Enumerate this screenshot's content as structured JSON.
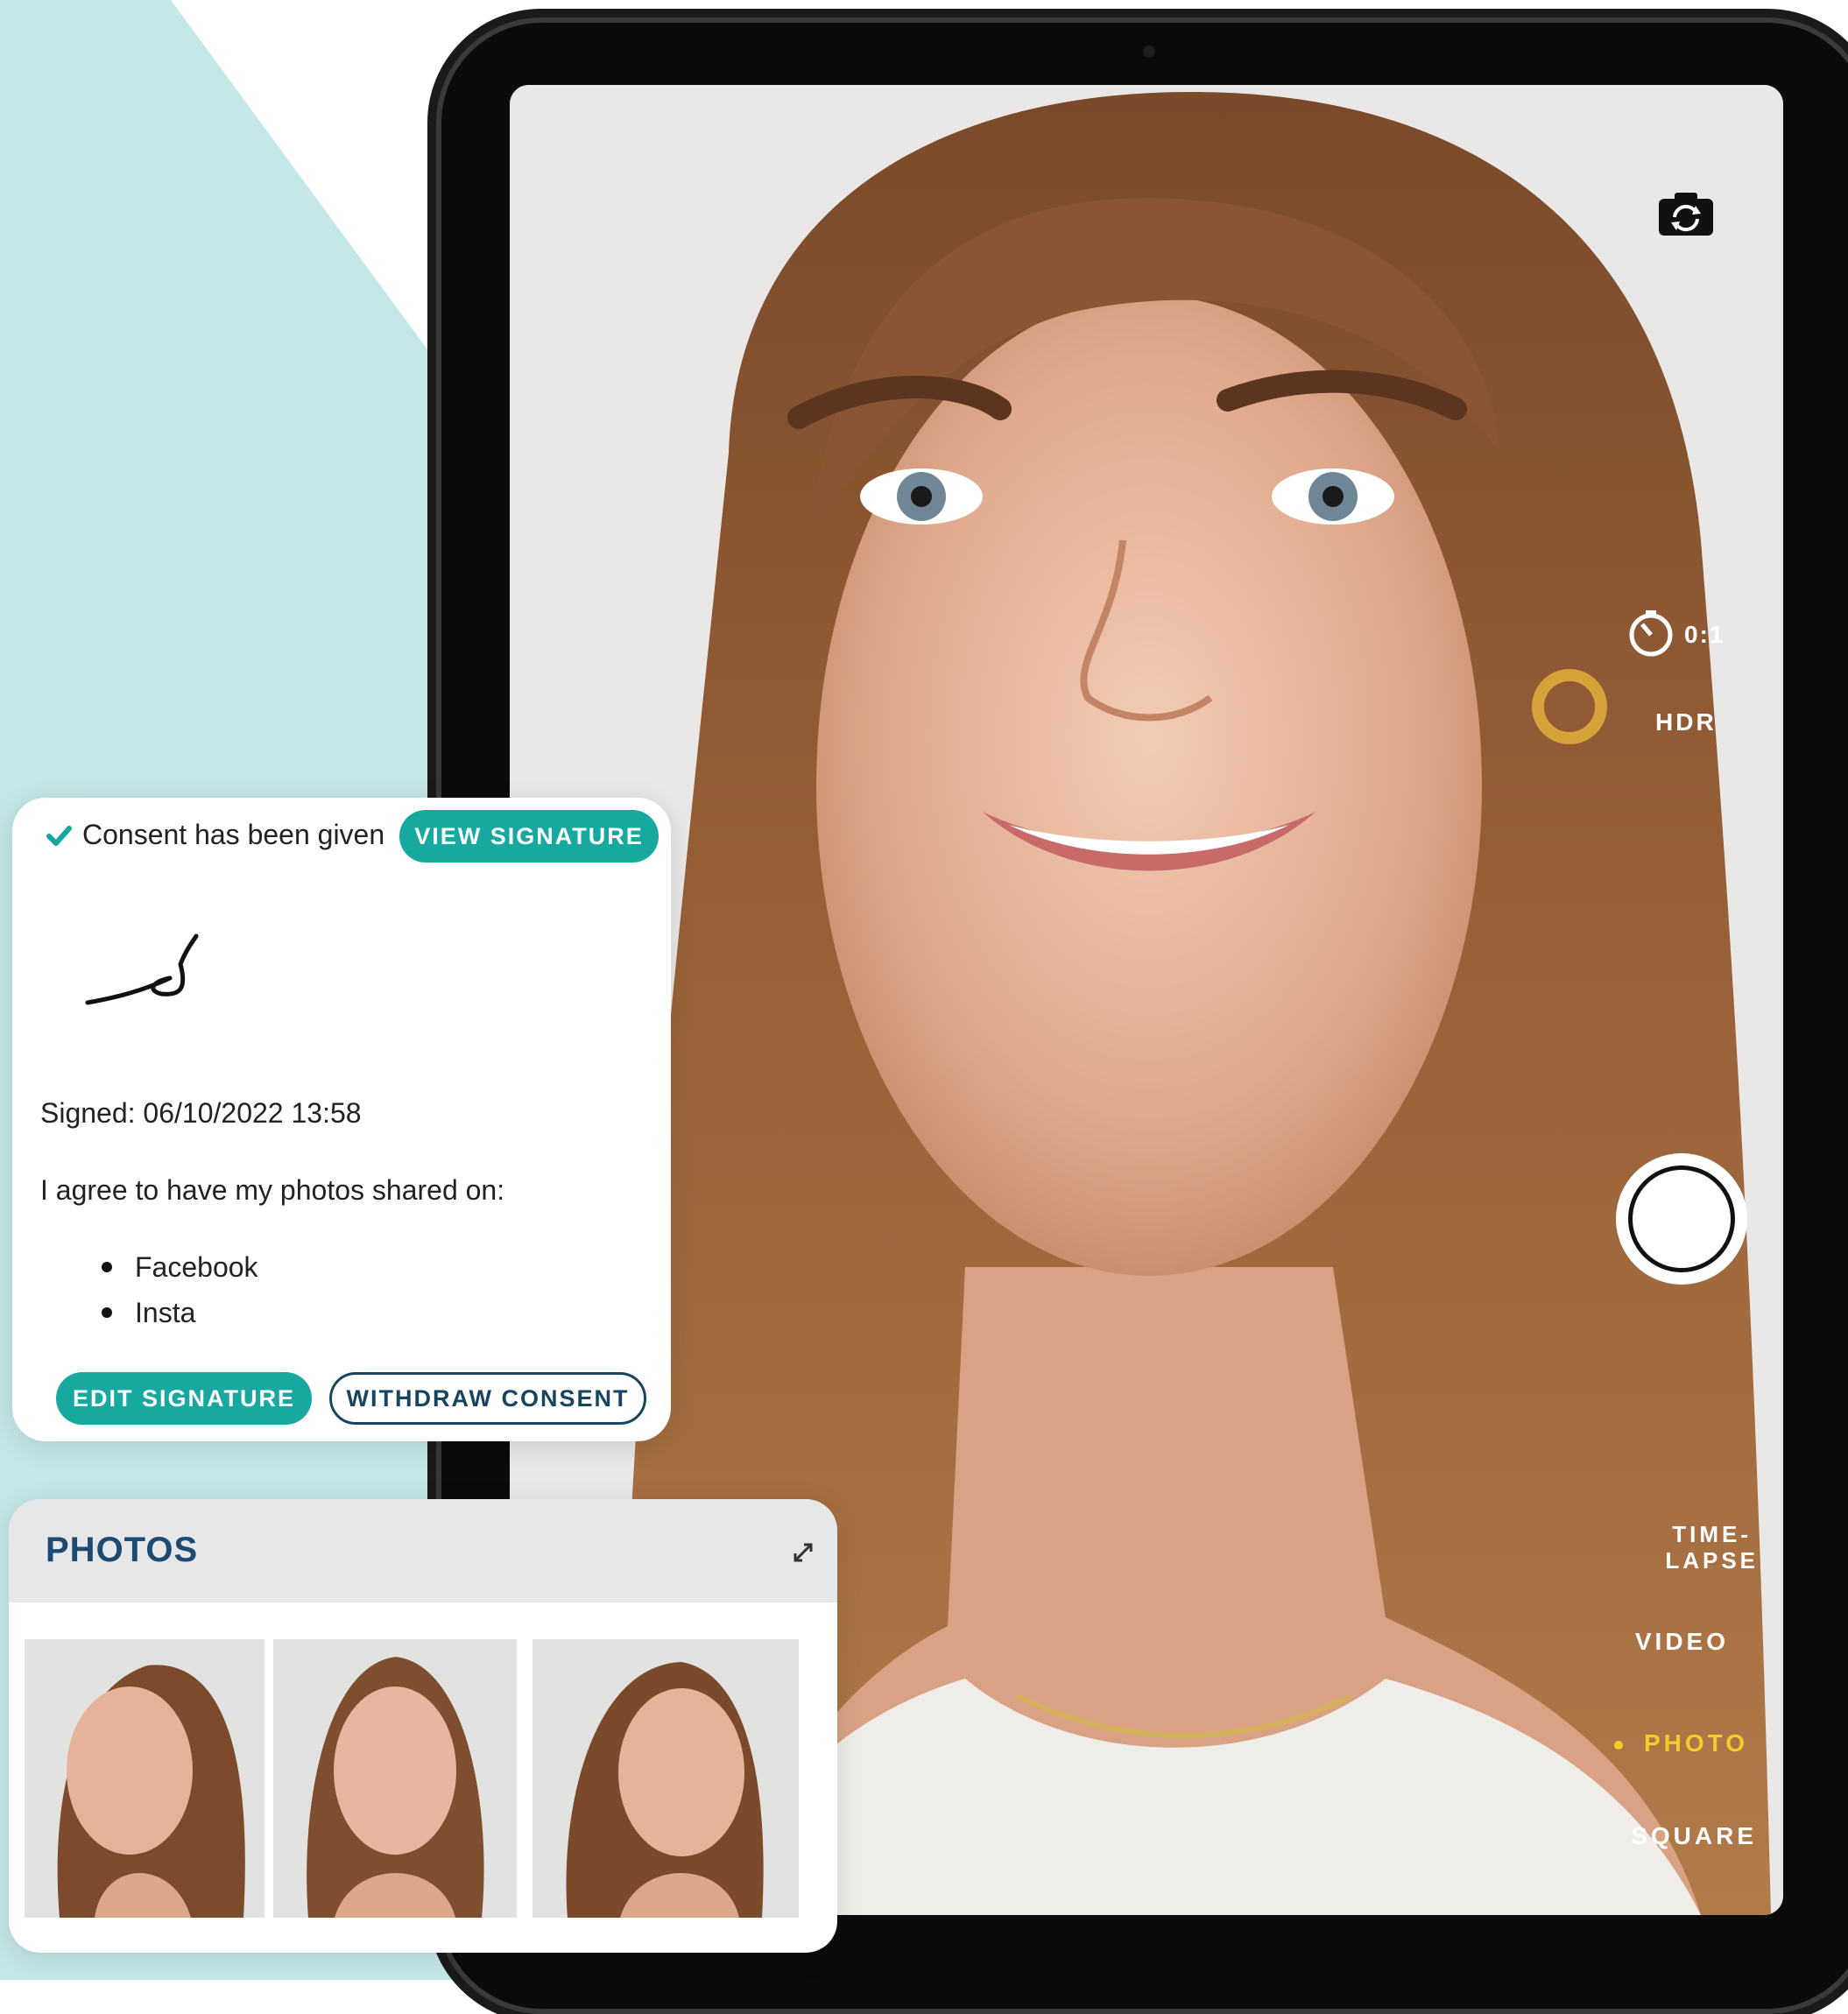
{
  "camera": {
    "timer_label": "0:1",
    "hdr_label": "HDR",
    "modes": {
      "timelapse": "TIME-\nLAPSE",
      "video": "VIDEO",
      "photo": "PHOTO",
      "square": "SQUARE"
    },
    "active_mode": "PHOTO",
    "colors": {
      "active_mode": "#f3cc29"
    }
  },
  "consent": {
    "status_text": "Consent has been given",
    "view_signature_label": "VIEW SIGNATURE",
    "signed_text": "Signed: 06/10/2022 13:58",
    "agree_text": "I agree to have my photos shared on:",
    "platforms": [
      "Facebook",
      "Insta"
    ],
    "edit_signature_label": "EDIT SIGNATURE",
    "withdraw_consent_label": "WITHDRAW CONSENT",
    "colors": {
      "accent": "#17a8a0",
      "outline": "#17445f"
    }
  },
  "photos": {
    "title": "PHOTOS"
  },
  "icons": [
    "flip-camera-icon",
    "timer-icon",
    "check-icon",
    "expand-icon"
  ]
}
